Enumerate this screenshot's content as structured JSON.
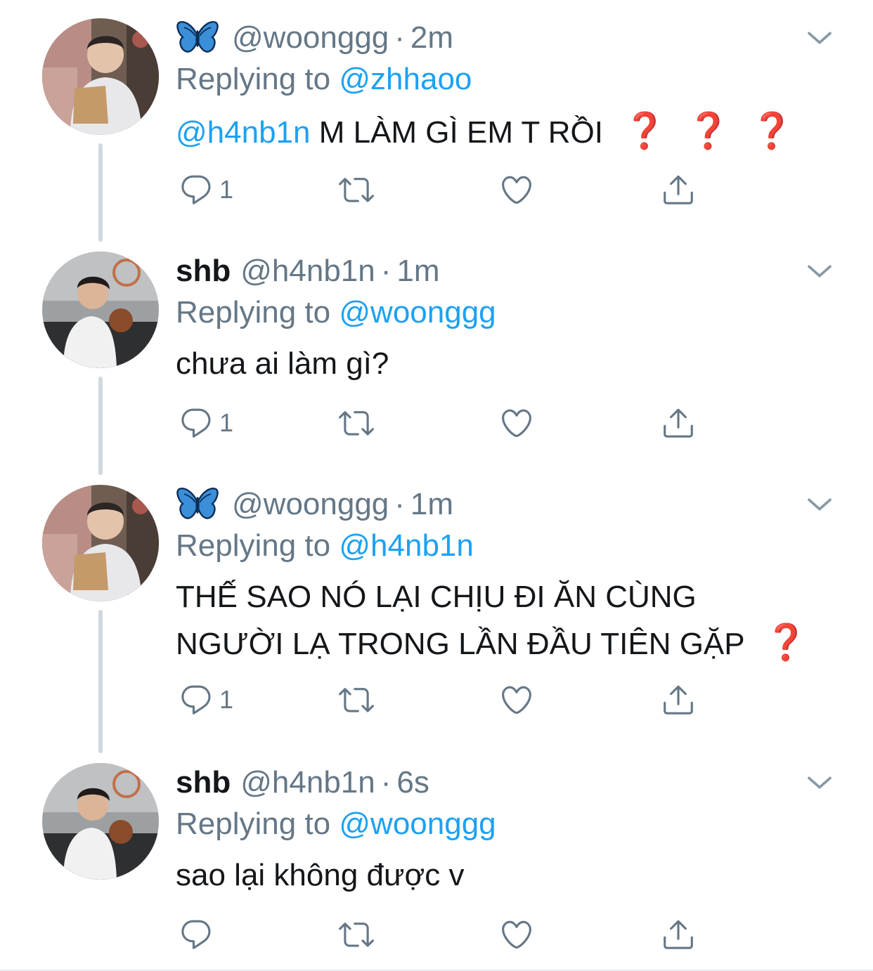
{
  "tweets": [
    {
      "display_name": "",
      "has_butterfly": true,
      "handle": "@woonggg",
      "dot": "·",
      "time": "2m",
      "replying_prefix": "Replying to",
      "replying_handle": "@zhhaoo",
      "mention": "@h4nb1n",
      "text": "M LÀM GÌ EM T RỒI",
      "qmarks": [
        "❓",
        "❓",
        "❓"
      ],
      "reply_count": "1"
    },
    {
      "display_name": "shb",
      "has_butterfly": false,
      "handle": "@h4nb1n",
      "dot": "·",
      "time": "1m",
      "replying_prefix": "Replying to",
      "replying_handle": "@woonggg",
      "mention": "",
      "text": "chưa ai làm gì?",
      "qmarks": [],
      "reply_count": "1"
    },
    {
      "display_name": "",
      "has_butterfly": true,
      "handle": "@woonggg",
      "dot": "·",
      "time": "1m",
      "replying_prefix": "Replying to",
      "replying_handle": "@h4nb1n",
      "mention": "",
      "text_line1": "THẾ SAO NÓ LẠI CHỊU ĐI ĂN CÙNG",
      "text_line2": "NGƯỜI LẠ TRONG LẦN ĐẦU TIÊN GẶP",
      "qmarks": [
        "❓"
      ],
      "reply_count": "1"
    },
    {
      "display_name": "shb",
      "has_butterfly": false,
      "handle": "@h4nb1n",
      "dot": "·",
      "time": "6s",
      "replying_prefix": "Replying to",
      "replying_handle": "@woonggg",
      "mention": "",
      "text": "sao lại không được v",
      "qmarks": [],
      "reply_count": ""
    }
  ],
  "icons": {
    "reply": "reply-icon",
    "retweet": "retweet-icon",
    "like": "heart-icon",
    "share": "share-icon",
    "caret": "chevron-down-icon",
    "butterfly": "butterfly-emoji-icon"
  },
  "colors": {
    "link": "#1da1f2",
    "muted": "#657786",
    "text": "#14171a",
    "qmark": "#c62828",
    "thread_line": "#cfd9de"
  }
}
